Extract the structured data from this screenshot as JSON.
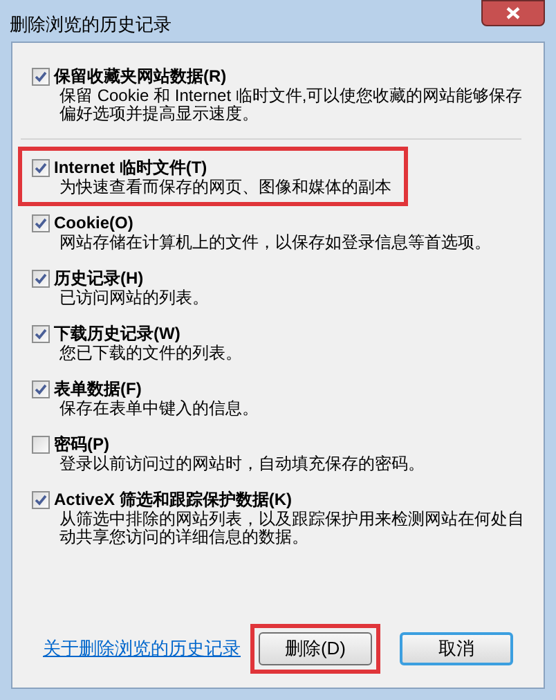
{
  "window": {
    "title": "删除浏览的历史记录"
  },
  "options": [
    {
      "label": "保留收藏夹网站数据(R)",
      "description": "保留 Cookie 和 Internet 临时文件,可以使您收藏的网站能够保存偏好选项并提高显示速度。",
      "checked": true,
      "highlighted": false,
      "separator_after": true
    },
    {
      "label": "Internet 临时文件(T)",
      "description": "为快速查看而保存的网页、图像和媒体的副本",
      "checked": true,
      "highlighted": true,
      "separator_after": false
    },
    {
      "label": "Cookie(O)",
      "description": "网站存储在计算机上的文件，以保存如登录信息等首选项。",
      "checked": true,
      "highlighted": false,
      "separator_after": false
    },
    {
      "label": "历史记录(H)",
      "description": "已访问网站的列表。",
      "checked": true,
      "highlighted": false,
      "separator_after": false
    },
    {
      "label": "下载历史记录(W)",
      "description": "您已下载的文件的列表。",
      "checked": true,
      "highlighted": false,
      "separator_after": false
    },
    {
      "label": "表单数据(F)",
      "description": "保存在表单中键入的信息。",
      "checked": true,
      "highlighted": false,
      "separator_after": false
    },
    {
      "label": "密码(P)",
      "description": "登录以前访问过的网站时，自动填充保存的密码。",
      "checked": false,
      "highlighted": false,
      "separator_after": false
    },
    {
      "label": "ActiveX 筛选和跟踪保护数据(K)",
      "description": "从筛选中排除的网站列表，以及跟踪保护用来检测网站在何处自动共享您访问的详细信息的数据。",
      "checked": true,
      "highlighted": false,
      "separator_after": false
    }
  ],
  "help_link": "关于删除浏览的历史记录",
  "buttons": [
    {
      "label": "删除(D)",
      "highlighted": true,
      "focused": false
    },
    {
      "label": "取消",
      "highlighted": false,
      "focused": true
    }
  ]
}
